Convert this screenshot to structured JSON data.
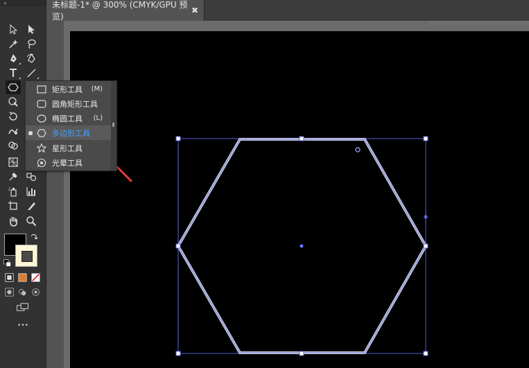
{
  "document_tab": {
    "title": "未标题-1* @ 300% (CMYK/GPU 预览)",
    "close_glyph": "✖"
  },
  "toolbar": {
    "collapse_glyph": "«",
    "more_glyph": "•••",
    "colors": {
      "fill": "#000000",
      "stroke": "#fff7d6"
    }
  },
  "flyout": {
    "items": [
      {
        "label": "矩形工具",
        "shortcut": "(M)",
        "icon": "rectangle-icon",
        "selected": false
      },
      {
        "label": "圆角矩形工具",
        "shortcut": "",
        "icon": "rounded-rectangle-icon",
        "selected": false
      },
      {
        "label": "椭圆工具",
        "shortcut": "(L)",
        "icon": "ellipse-icon",
        "selected": false
      },
      {
        "label": "多边形工具",
        "shortcut": "",
        "icon": "polygon-icon",
        "selected": true,
        "bullet": "■"
      },
      {
        "label": "星形工具",
        "shortcut": "",
        "icon": "star-icon",
        "selected": false
      },
      {
        "label": "光晕工具",
        "shortcut": "",
        "icon": "flare-icon",
        "selected": false
      }
    ]
  },
  "canvas": {
    "shape": "hexagon",
    "selection_color": "#5a63d8",
    "shape_stroke": "#dfe3f2",
    "artboard_background": "#000000",
    "annotation_arrow_color": "#e23b3b"
  }
}
